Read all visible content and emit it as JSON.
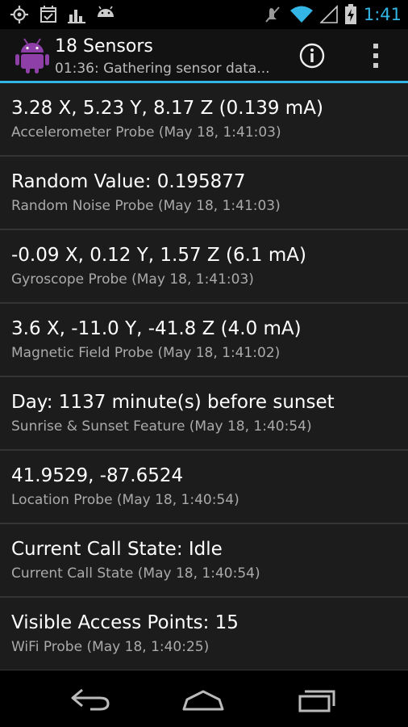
{
  "status_bar": {
    "time": "1:41",
    "left_icons": [
      "gps-icon",
      "calendar-check-icon",
      "bar-graph-icon",
      "android-icon"
    ],
    "right_icons": [
      "mute-icon",
      "wifi-icon",
      "signal-icon",
      "battery-charging-icon"
    ],
    "accent_color": "#33b5e5"
  },
  "action_bar": {
    "title": "18 Sensors",
    "subtitle": "01:36: Gathering sensor data...",
    "app_icon": "android-icon",
    "info_icon": "info-icon",
    "overflow_icon": "overflow-menu-icon",
    "accent_color": "#33b5e5"
  },
  "items": [
    {
      "value": "3.28 X, 5.23 Y, 8.17 Z (0.139 mA)",
      "source": "Accelerometer Probe (May 18, 1:41:03)"
    },
    {
      "value": "Random Value: 0.195877",
      "source": "Random Noise Probe (May 18, 1:41:03)"
    },
    {
      "value": "-0.09 X, 0.12 Y, 1.57 Z (6.1 mA)",
      "source": "Gyroscope Probe (May 18, 1:41:03)"
    },
    {
      "value": "3.6 X, -11.0 Y, -41.8 Z (4.0 mA)",
      "source": "Magnetic Field Probe (May 18, 1:41:02)"
    },
    {
      "value": "Day: 1137 minute(s) before sunset",
      "source": "Sunrise & Sunset Feature (May 18, 1:40:54)"
    },
    {
      "value": "41.9529, -87.6524",
      "source": "Location Probe (May 18, 1:40:54)"
    },
    {
      "value": "Current Call State: Idle",
      "source": "Current Call State (May 18, 1:40:54)"
    },
    {
      "value": "Visible Access Points: 15",
      "source": "WiFi Probe (May 18, 1:40:25)"
    }
  ],
  "nav_bar": {
    "icons": [
      "back-icon",
      "home-icon",
      "recents-icon"
    ]
  }
}
